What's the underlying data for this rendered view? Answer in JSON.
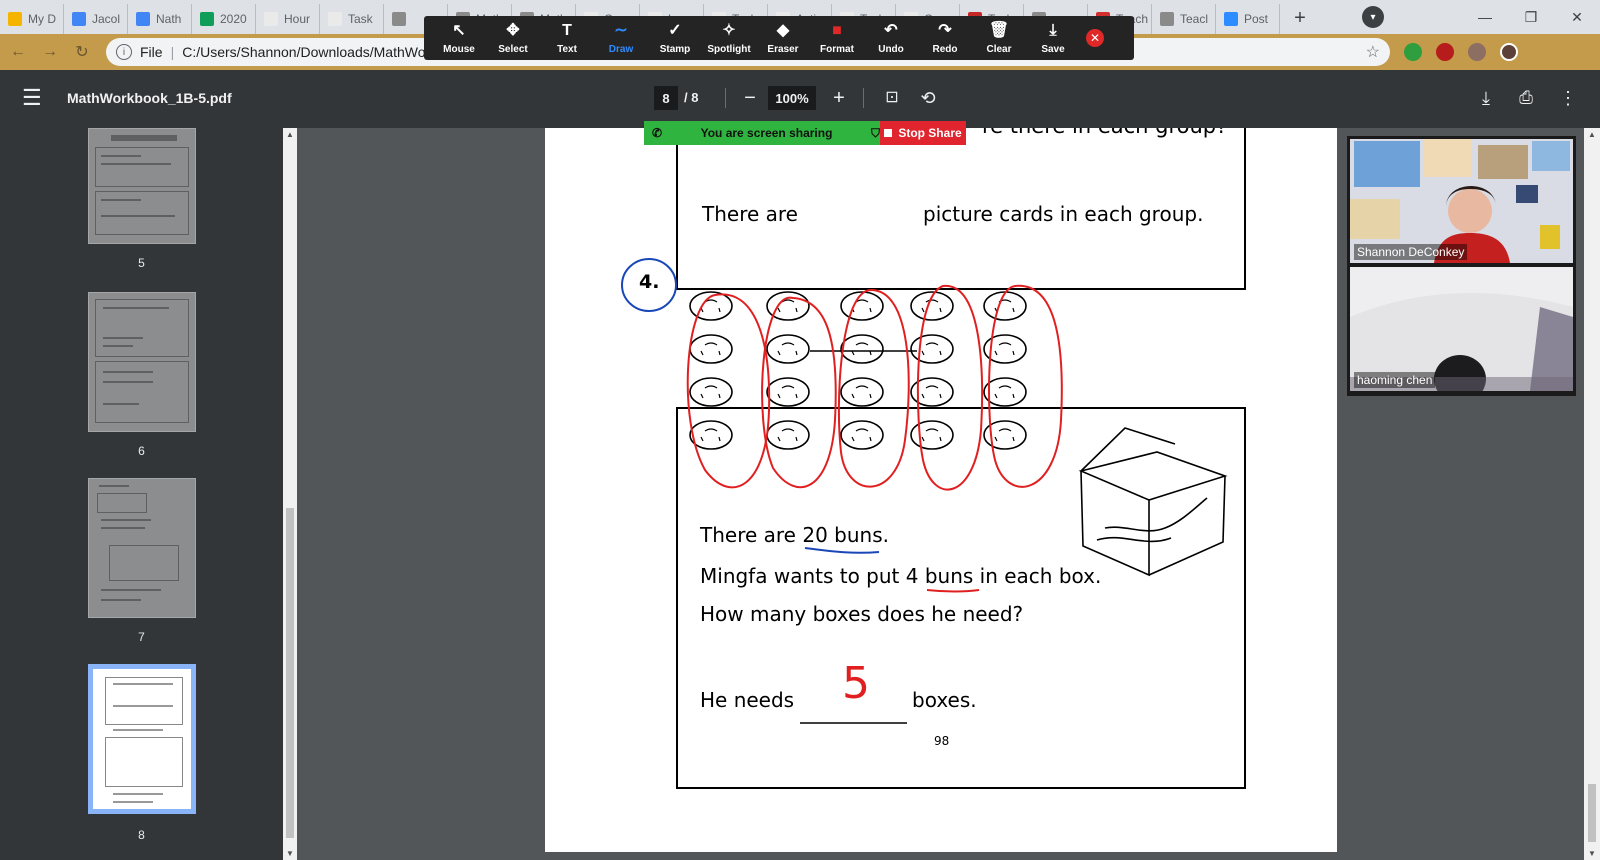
{
  "browser": {
    "tabs": [
      {
        "label": "My D",
        "color": "#f4b400"
      },
      {
        "label": "Jacol",
        "color": "#4285f4"
      },
      {
        "label": "Nath",
        "color": "#4285f4"
      },
      {
        "label": "2020",
        "color": "#0f9d58"
      },
      {
        "label": "Hour",
        "color": "#eaeaea"
      },
      {
        "label": "Task",
        "color": "#eaeaea"
      },
      {
        "label": "",
        "color": "#8a8a8a"
      },
      {
        "label": "Math",
        "color": "#8a8a8a"
      },
      {
        "label": "Math",
        "color": "#8a8a8a"
      },
      {
        "label": "Coun",
        "color": "#eaeaea"
      },
      {
        "label": "Lear",
        "color": "#eaeaea"
      },
      {
        "label": "Task",
        "color": "#eaeaea"
      },
      {
        "label": "Acti",
        "color": "#eaeaea"
      },
      {
        "label": "Task",
        "color": "#eaeaea"
      },
      {
        "label": "Cou",
        "color": "#eaeaea"
      },
      {
        "label": "Task",
        "color": "#c62828"
      },
      {
        "label": "",
        "color": "#8a8a8a"
      },
      {
        "label": "Teach",
        "color": "#d32f2f"
      },
      {
        "label": "Teacl",
        "color": "#8a8a8a"
      },
      {
        "label": "Post",
        "color": "#2d8cff"
      }
    ],
    "new_tab": "+",
    "address_scheme": "File",
    "address": "C:/Users/Shannon/Downloads/MathWo"
  },
  "zoom_toolbar": {
    "items": [
      {
        "label": "Mouse",
        "glyph": "↖"
      },
      {
        "label": "Select",
        "glyph": "✥"
      },
      {
        "label": "Text",
        "glyph": "T"
      },
      {
        "label": "Draw",
        "glyph": "∼",
        "active": true
      },
      {
        "label": "Stamp",
        "glyph": "✓"
      },
      {
        "label": "Spotlight",
        "glyph": "✧"
      },
      {
        "label": "Eraser",
        "glyph": "◆"
      },
      {
        "label": "Format",
        "glyph": "■",
        "color": "#e02828"
      },
      {
        "label": "Undo",
        "glyph": "↶"
      },
      {
        "label": "Redo",
        "glyph": "↷"
      },
      {
        "label": "Clear",
        "glyph": "🗑"
      },
      {
        "label": "Save",
        "glyph": "⤓"
      }
    ],
    "active_color": "#2d8cff"
  },
  "pdf": {
    "title": "MathWorkbook_1B-5.pdf",
    "current_page": "8",
    "total_pages": "/ 8",
    "zoom": "100%",
    "thumbnails": [
      {
        "number": "5"
      },
      {
        "number": "6"
      },
      {
        "number": "7"
      },
      {
        "number": "8",
        "selected": true
      }
    ]
  },
  "share_bar": {
    "message": "You are screen sharing",
    "stop_label": "Stop Share"
  },
  "worksheet": {
    "partial_line": "re there in each group?",
    "q3_sentence_a": "There are",
    "q3_sentence_b": "picture cards in each group.",
    "q4_number": "4.",
    "q4_line1": "There are 20 buns.",
    "q4_line2": "Mingfa wants to put 4 buns in each box.",
    "q4_line3": "How many boxes does he need?",
    "answer_prefix": "He needs",
    "answer_suffix": "boxes.",
    "handwritten_answer": "5",
    "page_number": "98",
    "buns": {
      "groups": 5,
      "per_group": 4
    },
    "ink_colors": {
      "red": "#e02020",
      "blue": "#1a47b8"
    }
  },
  "participants": [
    {
      "name": "Shannon DeConkey"
    },
    {
      "name": "haoming chen"
    }
  ]
}
